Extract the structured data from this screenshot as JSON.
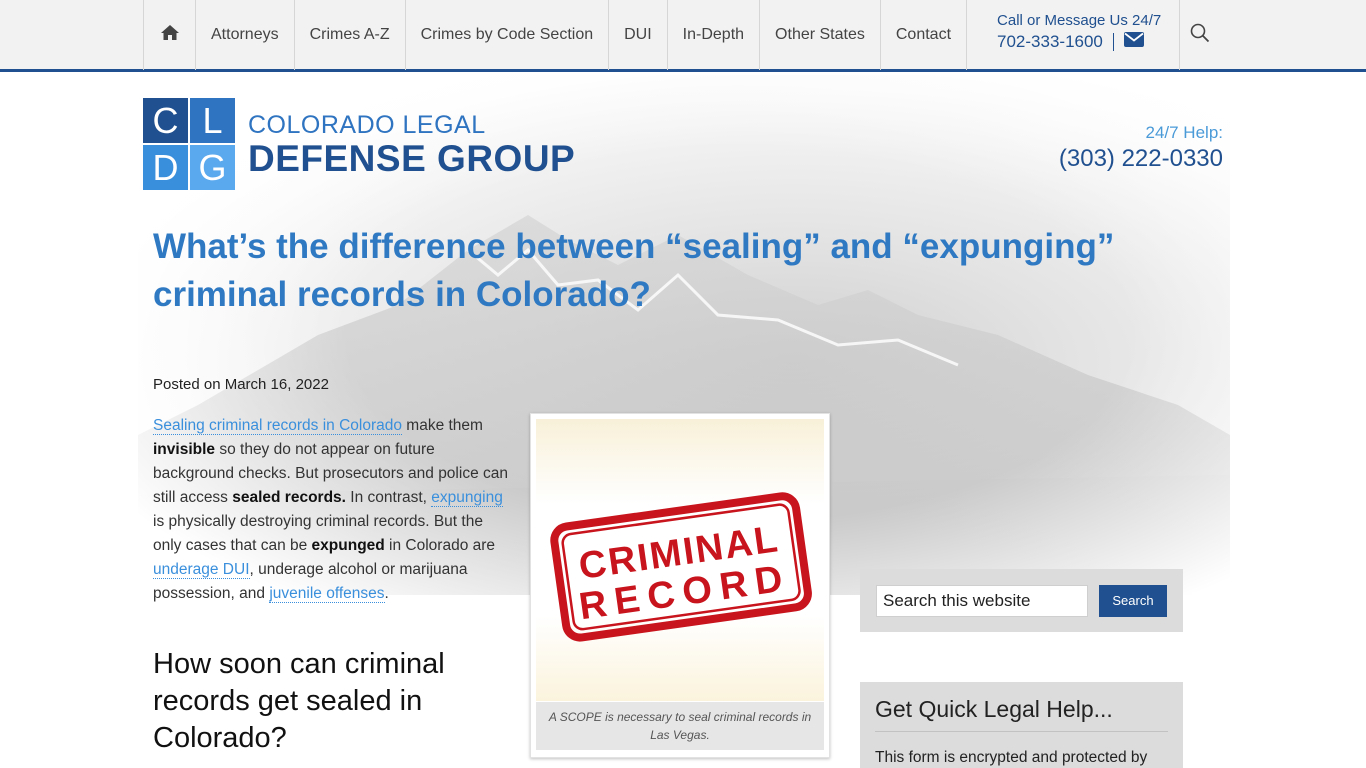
{
  "nav": {
    "items": [
      "Attorneys",
      "Crimes A-Z",
      "Crimes by Code Section",
      "DUI",
      "In-Depth",
      "Other States",
      "Contact"
    ],
    "call_label": "Call or Message Us 24/7",
    "call_phone": "702-333-1600"
  },
  "logo": {
    "letters": [
      "C",
      "L",
      "D",
      "G"
    ],
    "line1": "COLORADO LEGAL",
    "line2": "DEFENSE GROUP"
  },
  "help": {
    "label": "24/7 Help:",
    "phone": "(303) 222-0330"
  },
  "article": {
    "title": "What’s the difference between “sealing” and “expunging” criminal records in Colorado?",
    "posted": "Posted on March 16, 2022",
    "p1": {
      "link1": "Sealing criminal records in Colorado",
      "t1": " make them ",
      "b1": "invisible",
      "t2": " so they do not appear on future background checks. But prosecutors and police can still access ",
      "b2": "sealed records.",
      "t3": " In contrast, ",
      "link2": "expunging",
      "t4": " is physically destroying criminal records. But the only cases that can be ",
      "b3": "expunged",
      "t5": " in Colorado are ",
      "link3": "underage DUI",
      "t6": ", underage alcohol or marijuana possession, and ",
      "link4": "juvenile offenses",
      "t7": "."
    },
    "subheading": "How soon can criminal records get sealed in Colorado?",
    "figure": {
      "stamp_line1": "CRIMINAL",
      "stamp_line2": "RECORD",
      "caption": "A SCOPE is necessary to seal criminal records in Las Vegas."
    }
  },
  "sidebar": {
    "search_placeholder": "Search this website",
    "search_button": "Search",
    "quick_title": "Get Quick Legal Help...",
    "quick_text": "This form is encrypted and protected by"
  },
  "colors": {
    "brand_dark": "#20508f",
    "brand_light": "#2f79c3",
    "link": "#3a8fdc",
    "stamp_red": "#c8141c"
  },
  "icons": [
    "home-icon",
    "envelope-icon",
    "search-icon"
  ]
}
